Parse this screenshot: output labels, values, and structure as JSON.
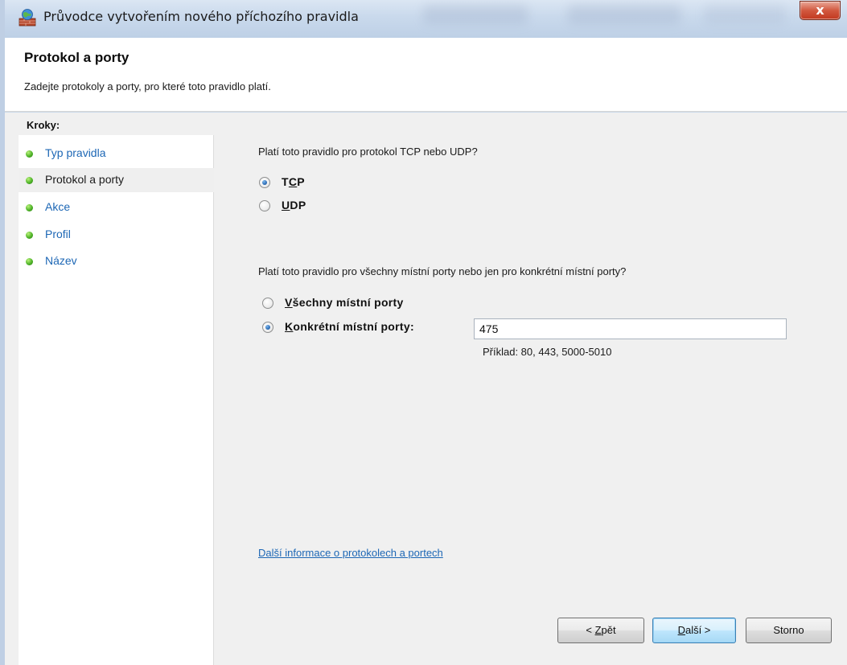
{
  "window": {
    "title": "Průvodce vytvořením nového příchozího pravidla",
    "close_label": "x"
  },
  "header": {
    "title": "Protokol a porty",
    "subtitle": "Zadejte protokoly a porty, pro které toto pravidlo platí."
  },
  "steps": {
    "heading": "Kroky:",
    "items": [
      {
        "label": "Typ pravidla",
        "current": false
      },
      {
        "label": "Protokol a porty",
        "current": true
      },
      {
        "label": "Akce",
        "current": false
      },
      {
        "label": "Profil",
        "current": false
      },
      {
        "label": "Název",
        "current": false
      }
    ]
  },
  "protocol": {
    "question": "Platí toto pravidlo pro protokol TCP nebo UDP?",
    "options": [
      {
        "label_pre": "T",
        "label_ul": "C",
        "label_post": "P",
        "checked": true
      },
      {
        "label_pre": "",
        "label_ul": "U",
        "label_post": "DP",
        "checked": false
      }
    ]
  },
  "ports": {
    "question": "Platí toto pravidlo pro všechny místní porty nebo jen pro konkrétní místní porty?",
    "all": {
      "label_ul": "V",
      "label_post": "šechny místní porty",
      "checked": false
    },
    "specific": {
      "label_ul": "K",
      "label_post": "onkrétní místní porty:",
      "checked": true
    },
    "value": "475",
    "example": "Příklad: 80, 443, 5000-5010"
  },
  "more_info_link": "Další informace o protokolech a portech",
  "buttons": {
    "back": {
      "pre": "< ",
      "ul": "Z",
      "post": "pět"
    },
    "next": {
      "ul": "D",
      "post": "alší >"
    },
    "cancel": "Storno"
  },
  "colors": {
    "link": "#1d67b5",
    "step_dot": "#4fb329",
    "close_button": "#c2371e"
  }
}
